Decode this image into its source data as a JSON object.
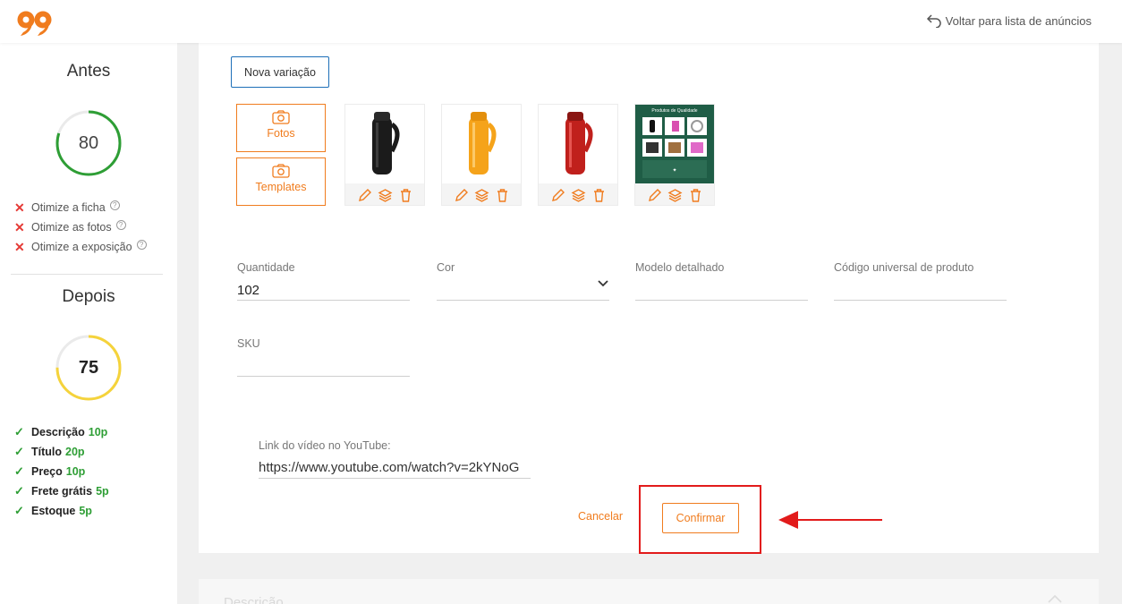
{
  "header": {
    "logo_icon": "99-logo",
    "back_label": "Voltar para lista de anúncios",
    "accent": "#f07c1e"
  },
  "sidebar": {
    "before": {
      "title": "Antes",
      "score": "80",
      "score_fraction": 0.8,
      "gauge_color": "#2e9e35",
      "criteria": [
        {
          "label": "Otimize a ficha"
        },
        {
          "label": "Otimize as fotos"
        },
        {
          "label": "Otimize a exposição"
        }
      ]
    },
    "after": {
      "title": "Depois",
      "score": "75",
      "score_fraction": 0.75,
      "gauge_color": "#f5d33b",
      "items": [
        {
          "label": "Descrição",
          "points": "10p"
        },
        {
          "label": "Título",
          "points": "20p"
        },
        {
          "label": "Preço",
          "points": "10p"
        },
        {
          "label": "Frete grátis",
          "points": "5p"
        },
        {
          "label": "Estoque",
          "points": "5p"
        }
      ]
    }
  },
  "variation": {
    "new_variation_label": "Nova variação",
    "photos_label": "Fotos",
    "templates_label": "Templates",
    "photo_thumbs": [
      {
        "name": "black-thermos",
        "color": "#1b1b1b"
      },
      {
        "name": "yellow-thermos",
        "color": "#f5a31a"
      },
      {
        "name": "red-thermos",
        "color": "#c0201c"
      },
      {
        "name": "quality-products-collage",
        "color": "#1f5d46"
      }
    ],
    "collage_caption": "Produtos de Qualidade",
    "fields": {
      "quantity": {
        "label": "Quantidade",
        "value": "102"
      },
      "color": {
        "label": "Cor",
        "value": ""
      },
      "model": {
        "label": "Modelo detalhado",
        "value": ""
      },
      "upc": {
        "label": "Código universal de produto",
        "value": ""
      },
      "sku": {
        "label": "SKU",
        "value": ""
      }
    },
    "youtube": {
      "label": "Link do vídeo no YouTube:",
      "value": "https://www.youtube.com/watch?v=2kYNoG"
    },
    "cancel_label": "Cancelar",
    "confirm_label": "Confirmar"
  },
  "description_section": {
    "title": "Descrição"
  }
}
